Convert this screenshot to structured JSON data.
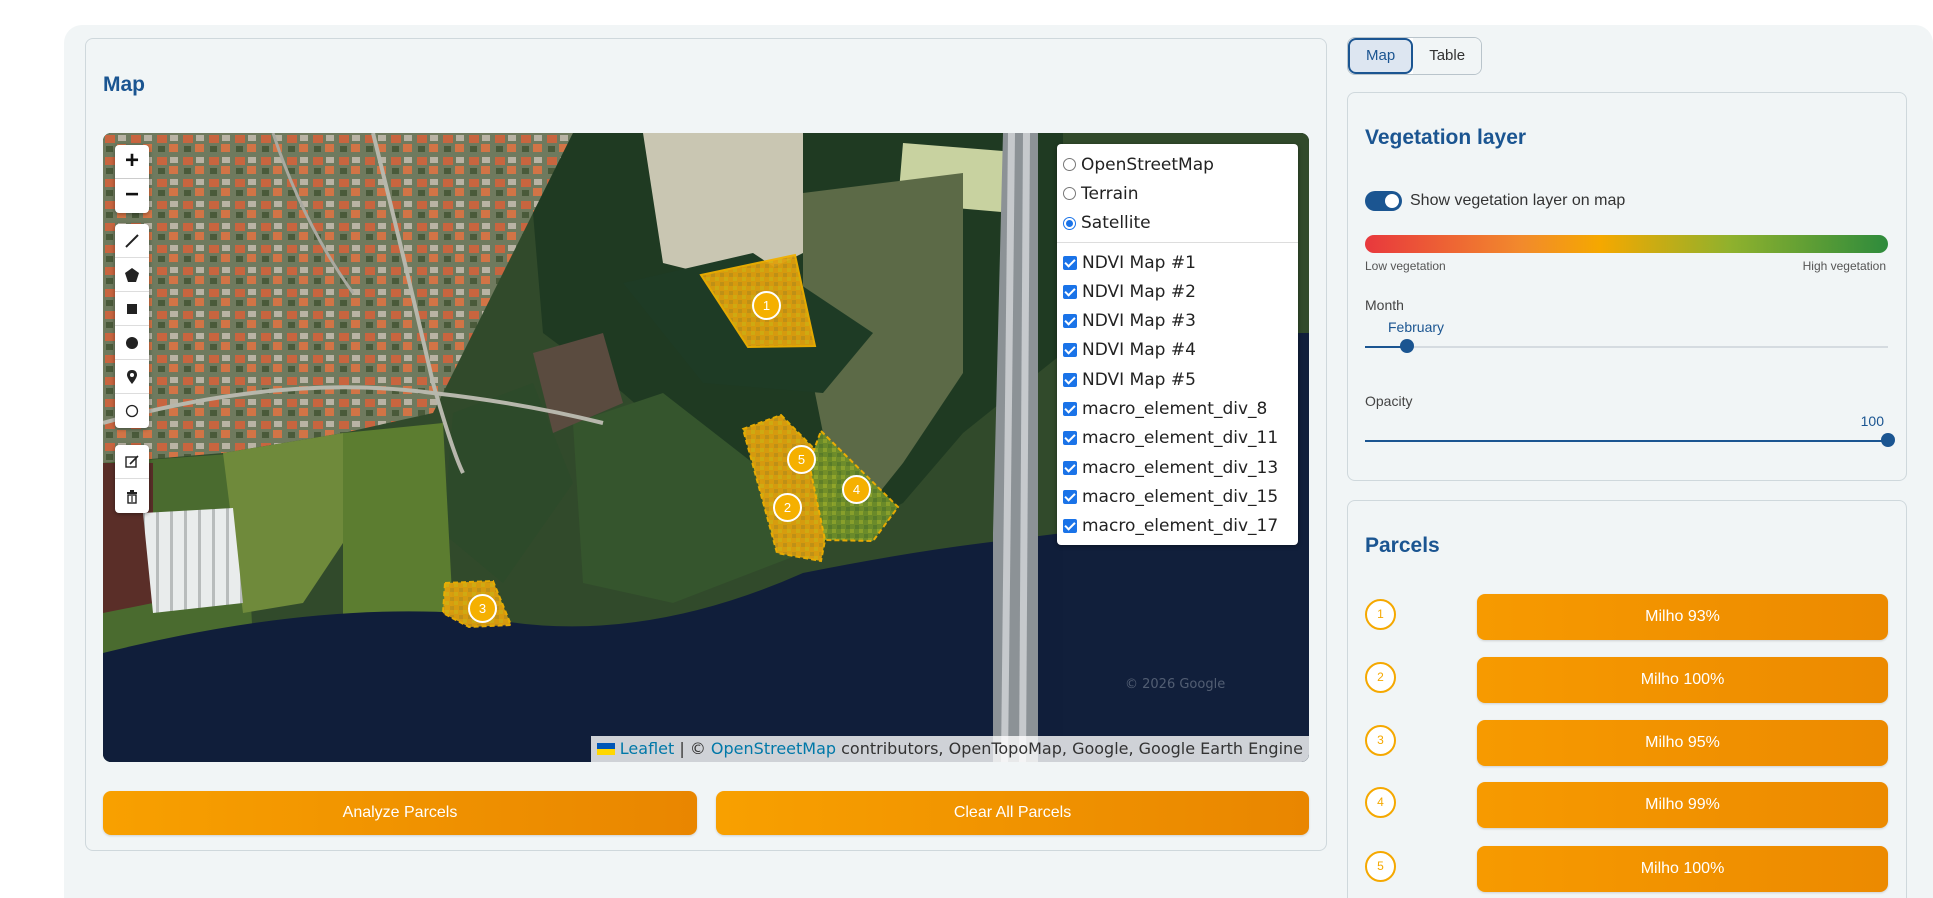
{
  "map_panel": {
    "title": "Map",
    "zoom_in": "+",
    "zoom_out": "−",
    "layers": {
      "base": [
        {
          "label": "OpenStreetMap",
          "selected": false
        },
        {
          "label": "Terrain",
          "selected": false
        },
        {
          "label": "Satellite",
          "selected": true
        }
      ],
      "overlays": [
        {
          "label": "NDVI Map #1",
          "checked": true
        },
        {
          "label": "NDVI Map #2",
          "checked": true
        },
        {
          "label": "NDVI Map #3",
          "checked": true
        },
        {
          "label": "NDVI Map #4",
          "checked": true
        },
        {
          "label": "NDVI Map #5",
          "checked": true
        },
        {
          "label": "macro_element_div_8",
          "checked": true
        },
        {
          "label": "macro_element_div_11",
          "checked": true
        },
        {
          "label": "macro_element_div_13",
          "checked": true
        },
        {
          "label": "macro_element_div_15",
          "checked": true
        },
        {
          "label": "macro_element_div_17",
          "checked": true
        }
      ]
    },
    "parcel_markers": [
      "1",
      "2",
      "3",
      "4",
      "5"
    ],
    "watermark": "© 2026 Google",
    "attribution": {
      "leaflet": "Leaflet",
      "separator": " | © ",
      "osm": "OpenStreetMap",
      "rest": " contributors, OpenTopoMap, Google, Google Earth Engine"
    },
    "analyze_label": "Analyze Parcels",
    "clear_label": "Clear All Parcels"
  },
  "tabs": [
    {
      "label": "Map",
      "active": true
    },
    {
      "label": "Table",
      "active": false
    }
  ],
  "vegetation": {
    "title": "Vegetation layer",
    "toggle_label": "Show vegetation layer on map",
    "toggle_on": true,
    "low_label": "Low vegetation",
    "high_label": "High vegetation",
    "month_label": "Month",
    "month_value": "February",
    "month_fraction": 0.08,
    "opacity_label": "Opacity",
    "opacity_value": "100",
    "opacity_fraction": 1.0
  },
  "parcels": {
    "title": "Parcels",
    "items": [
      {
        "number": "1",
        "label": "Milho 93%"
      },
      {
        "number": "2",
        "label": "Milho 100%"
      },
      {
        "number": "3",
        "label": "Milho 95%"
      },
      {
        "number": "4",
        "label": "Milho 99%"
      },
      {
        "number": "5",
        "label": "Milho 100%"
      }
    ]
  },
  "colors": {
    "accent": "#1b5591",
    "orange": "#f5a800",
    "layer_check": "#1a73e8"
  }
}
